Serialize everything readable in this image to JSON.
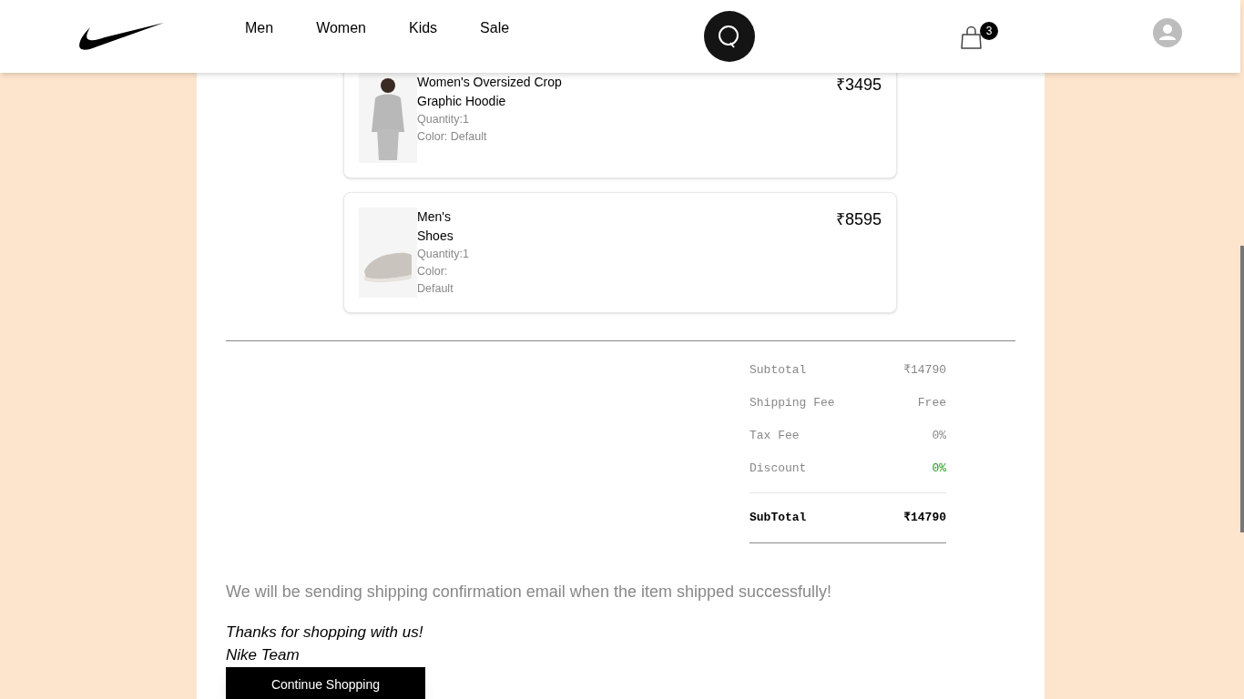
{
  "header": {
    "nav": [
      "Men",
      "Women",
      "Kids",
      "Sale"
    ],
    "cart_count": "3"
  },
  "items": [
    {
      "name": "Women's Oversized Crop Graphic Hoodie",
      "quantity": "Quantity:1",
      "color_text": "Color: Default",
      "price": "₹3495",
      "kind": "hoodie"
    },
    {
      "name": "Men's Shoes",
      "quantity": "Quantity:1",
      "color_text": "Color: Default",
      "price": "₹8595",
      "kind": "shoe"
    }
  ],
  "summary": {
    "rows": [
      {
        "label": "Subtotal",
        "value": "₹14790",
        "highlight": false
      },
      {
        "label": "Shipping Fee",
        "value": "Free",
        "highlight": false
      },
      {
        "label": "Tax Fee",
        "value": "0%",
        "highlight": false
      },
      {
        "label": "Discount",
        "value": "0%",
        "highlight": true
      }
    ],
    "total": {
      "label": "SubTotal",
      "value": "₹14790"
    }
  },
  "message": "We will be sending shipping confirmation email when the item shipped successfully!",
  "thanks": "Thanks for shopping with us!",
  "signature": "Nike Team",
  "button": "Continue Shopping"
}
